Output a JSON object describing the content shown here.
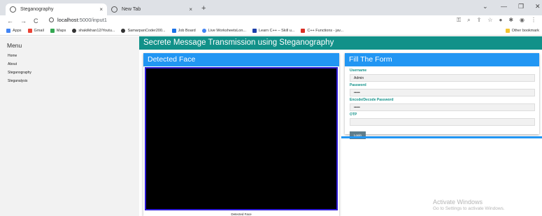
{
  "browser": {
    "tabs": [
      {
        "title": "Steganography",
        "close": "×"
      },
      {
        "title": "New Tab",
        "close": "×"
      }
    ],
    "new_tab": "+",
    "window_controls": [
      "⌄",
      "—",
      "❐",
      "✕"
    ],
    "nav": {
      "back": "←",
      "forward": "→",
      "reload": "C"
    },
    "url_host": "localhost",
    "url_path": ":5000/input1",
    "bookmarks": [
      "Apps",
      "Gmail",
      "Maps",
      "shakilkhan12/Youtu...",
      "SamarpanCoder200...",
      "Job Board",
      "Live WorksheetsLon...",
      "Learn C++ – Skill u...",
      "C++ Functions - jav..."
    ],
    "other_bookmarks": "Other bookmark",
    "bookmark_colors": [
      "#4285f4",
      "#ea4335",
      "#34a853",
      "#333333",
      "#333333",
      "#1a73e8",
      "#4285f4",
      "#1c3faa",
      "#d93025"
    ]
  },
  "sidebar": {
    "title": "Menu",
    "items": [
      "Home",
      "About",
      "Steganography",
      "Steganalysis"
    ]
  },
  "header": {
    "title": "Secrete Message Transmission using Steganography"
  },
  "face_panel": {
    "title": "Detected Face",
    "caption": "Detected Face"
  },
  "form": {
    "title": "Fill The Form",
    "username_label": "Username",
    "username_value": "Admin",
    "password_label": "Password",
    "password_value": "•••••",
    "encode_label": "Encode/Decode Password",
    "encode_value": "•••••",
    "otp_label": "OTP",
    "otp_value": "",
    "login_button": "Login"
  },
  "watermark": {
    "title": "Activate Windows",
    "subtitle": "Go to Settings to activate Windows."
  },
  "colors": {
    "header": "#119189",
    "card_header": "#2196f3",
    "button": "#607d8b"
  }
}
